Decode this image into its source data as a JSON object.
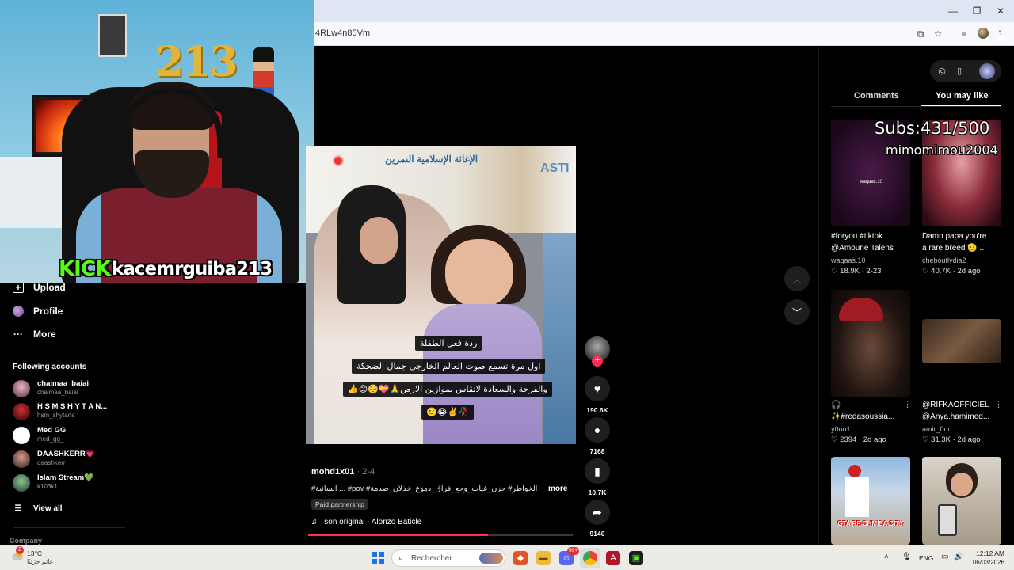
{
  "browser": {
    "url_fragment": "4RLw4n85Vm"
  },
  "sidebar": {
    "nav": [
      {
        "label": "Upload"
      },
      {
        "label": "Profile"
      },
      {
        "label": "More"
      }
    ],
    "following_title": "Following accounts",
    "accounts": [
      {
        "name": "chaimaa_baiai",
        "handle": "chaimaa_baiai"
      },
      {
        "name": "H S M  S H Y T A N...",
        "handle": "hsm_shytana"
      },
      {
        "name": "Med GG",
        "handle": "med_gg_"
      },
      {
        "name": "DAASHKERR💗",
        "handle": "daashkerr"
      },
      {
        "name": "Islam Stream💚",
        "handle": "k103k1"
      }
    ],
    "view_all": "View all",
    "company": "Company"
  },
  "webcam": {
    "balloon_number": "213",
    "platform": "KICK",
    "streamer": "kacemrguiba213"
  },
  "video": {
    "banner_text": "الإغاثة الإسلامية النمرين",
    "banner_brand": "ASTI",
    "captions": [
      "ردة فعل الطفلة",
      "اول مرة تسمع صوت العالم الخارجي جمال الضحكة",
      "والفرحة والسعادة لاتقاس بموازين الارض🙏💝🥺😊👍",
      "🥀✌️😭🙂"
    ],
    "author": "mohd1x01",
    "date": "· 2-4",
    "description": "#انسانية ... #pov #الخواطر# حزن_غياب_وجع_فراق_دموع_خذلان_صدمة",
    "more": "more",
    "paid_partnership": "Paid partnership",
    "sound": "son original - Alonzo Baticle",
    "progress": 0.68
  },
  "actions": {
    "likes": "190.6K",
    "comments": "7168",
    "saves": "10.7K",
    "shares": "9140"
  },
  "right_panel": {
    "tabs": [
      {
        "label": "Comments"
      },
      {
        "label": "You may like"
      }
    ],
    "overlay_subs": "Subs:431/500",
    "overlay_user": "mimomimou2004",
    "cards": [
      {
        "title1": "#foryou #tiktok",
        "title2": "@Amoune Talens",
        "user": "waqaas.10",
        "likes": "18.9K",
        "date": "2-23"
      },
      {
        "title1": "Damn papa you're",
        "title2": "a rare breed 🫡 ...",
        "user": "cheboutlydia2",
        "likes": "40.7K",
        "date": "2d ago"
      },
      {
        "title1": "🎧",
        "title2": "✨#redasoussia...",
        "user": "y0uo1",
        "likes": "2394",
        "date": "2d ago"
      },
      {
        "title1": "@RIFKAOFFICIEL",
        "title2": "@Anya.hamimed...",
        "user": "amir_0uu",
        "likes": "31.3K",
        "date": "2d ago"
      }
    ],
    "thumb3_text": "GTA RP CHMISA CITY",
    "thumb1_tag": "waqaas.10"
  },
  "taskbar": {
    "temp": "13°C",
    "condition": "غائم جزئيًا",
    "weather_badge": "2",
    "search_placeholder": "Rechercher",
    "lang": "ENG",
    "time": "12:12 AM",
    "date": "06/03/2026",
    "discord_badge": "99+"
  },
  "colors": {
    "accent_pink": "#fe2c55",
    "kick_green": "#53fc18"
  }
}
